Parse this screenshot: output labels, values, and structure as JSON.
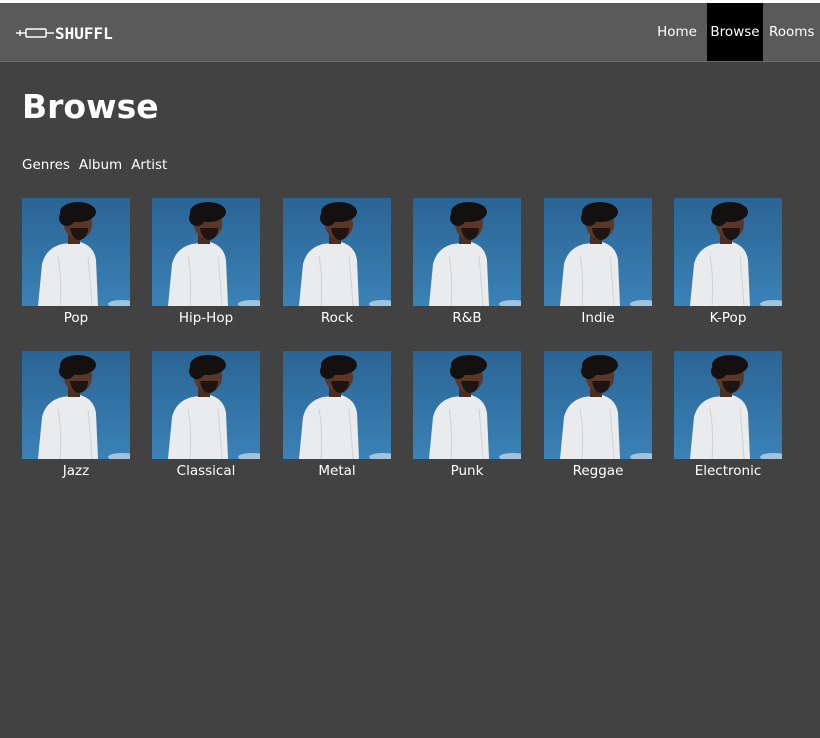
{
  "app": {
    "brand": "SHUFFL"
  },
  "nav": {
    "items": [
      {
        "label": "Home"
      },
      {
        "label": "Browse",
        "active": true
      },
      {
        "label": "Rooms"
      }
    ]
  },
  "page": {
    "title": "Browse"
  },
  "tabs": [
    {
      "label": "Genres"
    },
    {
      "label": "Album"
    },
    {
      "label": "Artist"
    }
  ],
  "genres": [
    {
      "label": "Pop"
    },
    {
      "label": "Hip-Hop"
    },
    {
      "label": "Rock"
    },
    {
      "label": "R&B"
    },
    {
      "label": "Indie"
    },
    {
      "label": "K-Pop"
    },
    {
      "label": "Jazz"
    },
    {
      "label": "Classical"
    },
    {
      "label": "Metal"
    },
    {
      "label": "Punk"
    },
    {
      "label": "Reggae"
    },
    {
      "label": "Electronic"
    }
  ],
  "colors": {
    "page_bg": "#424242",
    "navbar_bg": "#5a5a5a",
    "active_nav_bg": "#000000",
    "text": "#ffffff",
    "cover_sky": "#2f6fa0"
  }
}
